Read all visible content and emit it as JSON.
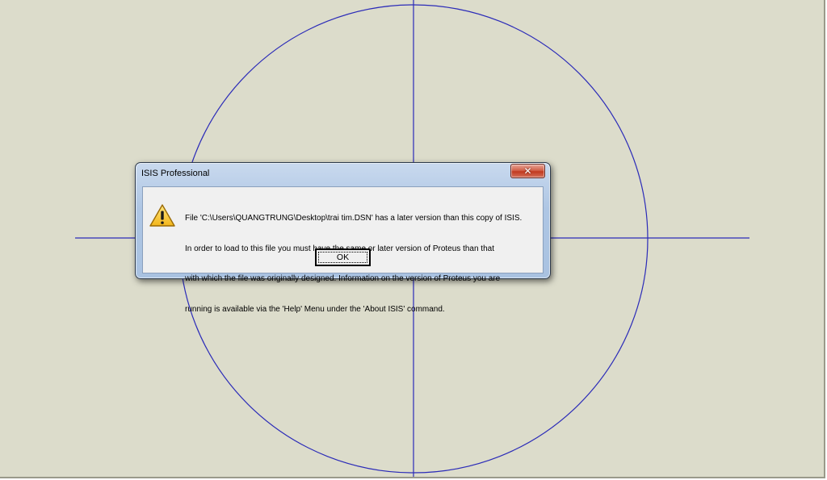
{
  "dialog": {
    "title": "ISIS Professional",
    "close_icon": "close-icon",
    "warning_icon": "warning-triangle-icon",
    "message_lines": [
      "File 'C:\\Users\\QUANGTRUNG\\Desktop\\trai tim.DSN' has a later version than this copy of ISIS.",
      "In order to load to this file you must have the same or later version of Proteus than that",
      "with which the file was originally designed. Information on the version of Proteus you are",
      "running is available via the 'Help' Menu under the 'About ISIS' command."
    ],
    "ok_label": "OK"
  },
  "colors": {
    "canvas_background": "#dcdccb",
    "drawing_lines": "#2b2bb8",
    "close_button": "#c13a1f"
  }
}
